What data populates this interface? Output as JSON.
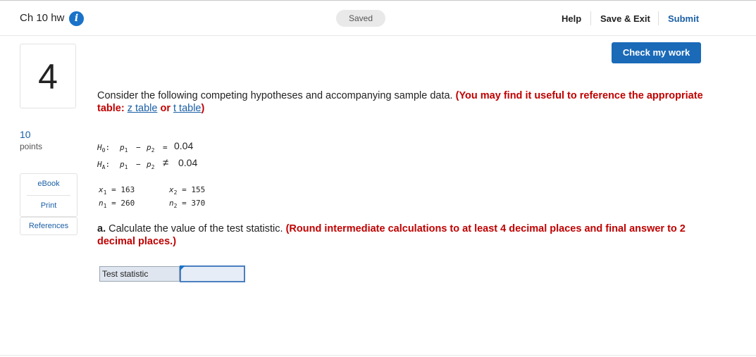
{
  "header": {
    "assignment_title": "Ch 10 hw",
    "info_icon": "i",
    "status": "Saved",
    "help_label": "Help",
    "save_exit_label": "Save & Exit",
    "submit_label": "Submit"
  },
  "question": {
    "number": "4",
    "points_value": "10",
    "points_label": "points"
  },
  "sidebar": {
    "ebook": "eBook",
    "print": "Print",
    "references": "References"
  },
  "toolbar": {
    "check_my_work": "Check my work"
  },
  "prompt": {
    "intro": "Consider the following competing hypotheses and accompanying sample data.",
    "note_start": "(You may find it useful to reference the appropriate table:",
    "z_table": "z table",
    "or": "or",
    "t_table": "t table",
    "note_end": ")"
  },
  "hypotheses": {
    "h0_label": "H",
    "h0_sub": "0",
    "ha_label": "H",
    "ha_sub": "A",
    "p1": "p",
    "p1_sub": "1",
    "p2": "p",
    "p2_sub": "2",
    "minus": "−",
    "colon": ":",
    "eq": "=",
    "neq": "≠",
    "value": "0.04"
  },
  "samples": {
    "x1_var": "x",
    "x1_sub": "1",
    "x1_value": "163",
    "n1_var": "n",
    "n1_sub": "1",
    "n1_value": "260",
    "x2_var": "x",
    "x2_sub": "2",
    "x2_value": "155",
    "n2_var": "n",
    "n2_sub": "2",
    "n2_value": "370",
    "eq": "="
  },
  "part_a": {
    "lead": "a.",
    "text": "Calculate the value of the test statistic.",
    "instruction": "(Round intermediate calculations to at least 4 decimal places and final answer to 2 decimal places.)"
  },
  "answer": {
    "label": "Test statistic",
    "value": ""
  },
  "colors": {
    "accent": "#1a6ab8",
    "link": "#1b5fa5",
    "alert": "#c00000"
  }
}
